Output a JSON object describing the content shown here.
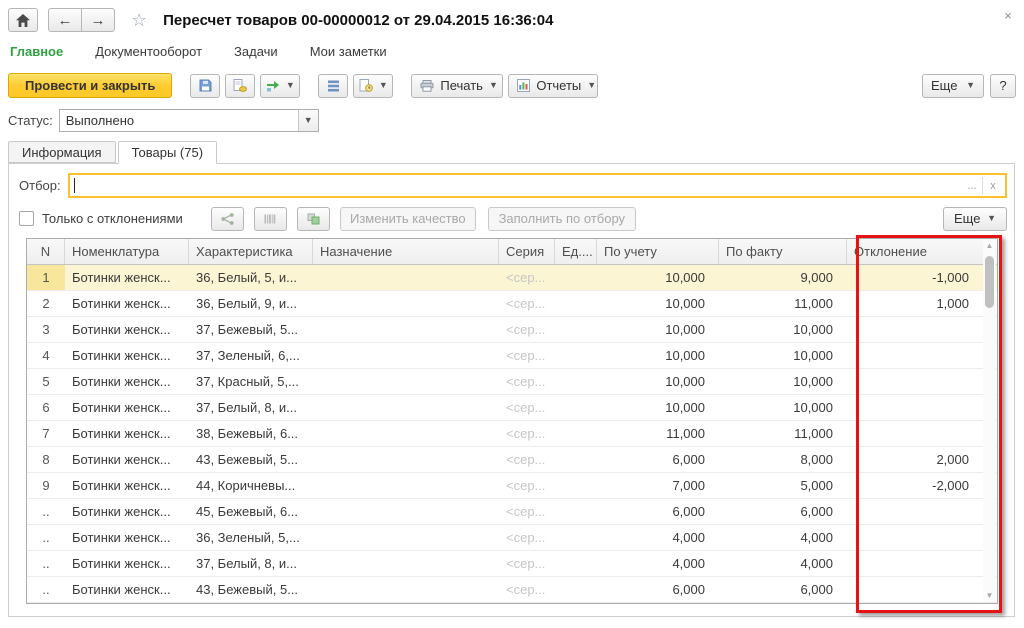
{
  "window": {
    "title": "Пересчет товаров 00-00000012 от 29.04.2015 16:36:04",
    "close": "×",
    "back": "←",
    "forward": "→",
    "favorite_star": "☆"
  },
  "menu": {
    "items": [
      {
        "label": "Главное"
      },
      {
        "label": "Документооборот"
      },
      {
        "label": "Задачи"
      },
      {
        "label": "Мои заметки"
      }
    ]
  },
  "toolbar": {
    "post_and_close": "Провести и закрыть",
    "print": "Печать",
    "reports": "Отчеты",
    "more": "Еще",
    "help": "?"
  },
  "status": {
    "label": "Статус:",
    "value": "Выполнено"
  },
  "tabs": {
    "info": "Информация",
    "goods": "Товары (75)"
  },
  "filter": {
    "label": "Отбор:",
    "value": "",
    "ellipsis": "...",
    "clear": "x"
  },
  "actions": {
    "only_deviations": "Только с отклонениями",
    "change_quality": "Изменить качество",
    "fill_by_filter": "Заполнить по отбору",
    "more": "Еще"
  },
  "table": {
    "columns": [
      "N",
      "Номенклатура",
      "Характеристика",
      "Назначение",
      "Серия",
      "Ед....",
      "По учету",
      "По факту",
      "Отклонение"
    ],
    "rows": [
      {
        "n": "1",
        "nomen": "Ботинки женск...",
        "char": "36, Белый, 5, и...",
        "naz": "",
        "seria": "<сер...",
        "ed": "",
        "uchet": "10,000",
        "fakt": "9,000",
        "otkl": "-1,000",
        "selected": true
      },
      {
        "n": "2",
        "nomen": "Ботинки женск...",
        "char": "36, Белый, 9, и...",
        "naz": "",
        "seria": "<сер...",
        "ed": "",
        "uchet": "10,000",
        "fakt": "11,000",
        "otkl": "1,000"
      },
      {
        "n": "3",
        "nomen": "Ботинки женск...",
        "char": "37, Бежевый, 5...",
        "naz": "",
        "seria": "<сер...",
        "ed": "",
        "uchet": "10,000",
        "fakt": "10,000",
        "otkl": ""
      },
      {
        "n": "4",
        "nomen": "Ботинки женск...",
        "char": "37, Зеленый, 6,...",
        "naz": "",
        "seria": "<сер...",
        "ed": "",
        "uchet": "10,000",
        "fakt": "10,000",
        "otkl": ""
      },
      {
        "n": "5",
        "nomen": "Ботинки женск...",
        "char": "37, Красный, 5,...",
        "naz": "",
        "seria": "<сер...",
        "ed": "",
        "uchet": "10,000",
        "fakt": "10,000",
        "otkl": ""
      },
      {
        "n": "6",
        "nomen": "Ботинки женск...",
        "char": "37, Белый, 8, и...",
        "naz": "",
        "seria": "<сер...",
        "ed": "",
        "uchet": "10,000",
        "fakt": "10,000",
        "otkl": ""
      },
      {
        "n": "7",
        "nomen": "Ботинки женск...",
        "char": "38, Бежевый, 6...",
        "naz": "",
        "seria": "<сер...",
        "ed": "",
        "uchet": "11,000",
        "fakt": "11,000",
        "otkl": ""
      },
      {
        "n": "8",
        "nomen": "Ботинки женск...",
        "char": "43, Бежевый, 5...",
        "naz": "",
        "seria": "<сер...",
        "ed": "",
        "uchet": "6,000",
        "fakt": "8,000",
        "otkl": "2,000"
      },
      {
        "n": "9",
        "nomen": "Ботинки женск...",
        "char": "44, Коричневы...",
        "naz": "",
        "seria": "<сер...",
        "ed": "",
        "uchet": "7,000",
        "fakt": "5,000",
        "otkl": "-2,000"
      },
      {
        "n": "..",
        "nomen": "Ботинки женск...",
        "char": "45, Бежевый, 6...",
        "naz": "",
        "seria": "<сер...",
        "ed": "",
        "uchet": "6,000",
        "fakt": "6,000",
        "otkl": ""
      },
      {
        "n": "..",
        "nomen": "Ботинки женск...",
        "char": "36, Зеленый, 5,...",
        "naz": "",
        "seria": "<сер...",
        "ed": "",
        "uchet": "4,000",
        "fakt": "4,000",
        "otkl": ""
      },
      {
        "n": "..",
        "nomen": "Ботинки женск...",
        "char": "37, Белый, 8, и...",
        "naz": "",
        "seria": "<сер...",
        "ed": "",
        "uchet": "4,000",
        "fakt": "4,000",
        "otkl": ""
      },
      {
        "n": "..",
        "nomen": "Ботинки женск...",
        "char": "43, Бежевый, 5...",
        "naz": "",
        "seria": "<сер...",
        "ed": "",
        "uchet": "6,000",
        "fakt": "6,000",
        "otkl": ""
      }
    ]
  },
  "colors": {
    "accent_yellow": "#FBC926",
    "annotation_red": "#E51313",
    "selected_row": "#FCF5D3",
    "menu_green": "#2FA13F"
  }
}
